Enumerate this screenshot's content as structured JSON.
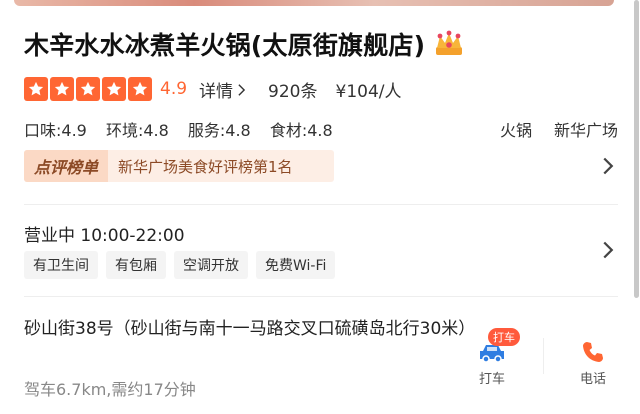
{
  "shop": {
    "name": "木辛水水冰煮羊火锅(太原街旗舰店)",
    "rating_stars": 5,
    "score": "4.9",
    "detail_label": "详情",
    "reviews": "920条",
    "price": "¥104/人"
  },
  "sub_scores": [
    {
      "text": "口味:4.9"
    },
    {
      "text": "环境:4.8"
    },
    {
      "text": "服务:4.8"
    },
    {
      "text": "食材:4.8"
    }
  ],
  "tags": [
    "火锅",
    "新华广场"
  ],
  "rank": {
    "label": "点评榜单",
    "text": "新华广场美食好评榜第1名"
  },
  "hours": "营业中 10:00-22:00",
  "facilities": [
    "有卫生间",
    "有包厢",
    "空调开放",
    "免费Wi-Fi"
  ],
  "address": "砂山街38号（砂山街与南十一马路交叉口硫磺岛北行30米）",
  "distance": "驾车6.7km,需约17分钟",
  "actions": {
    "taxi_badge": "打车",
    "taxi_label": "打车",
    "phone_label": "电话"
  },
  "colors": {
    "accent": "#ff6633",
    "rank_text": "#8c4a26",
    "badge": "#ff5a3c",
    "taxi_icon": "#2f7de1",
    "phone_icon": "#ff6633"
  },
  "icons": [
    "crown-icon",
    "star-icon",
    "chevron-right-icon",
    "car-icon",
    "phone-icon"
  ]
}
